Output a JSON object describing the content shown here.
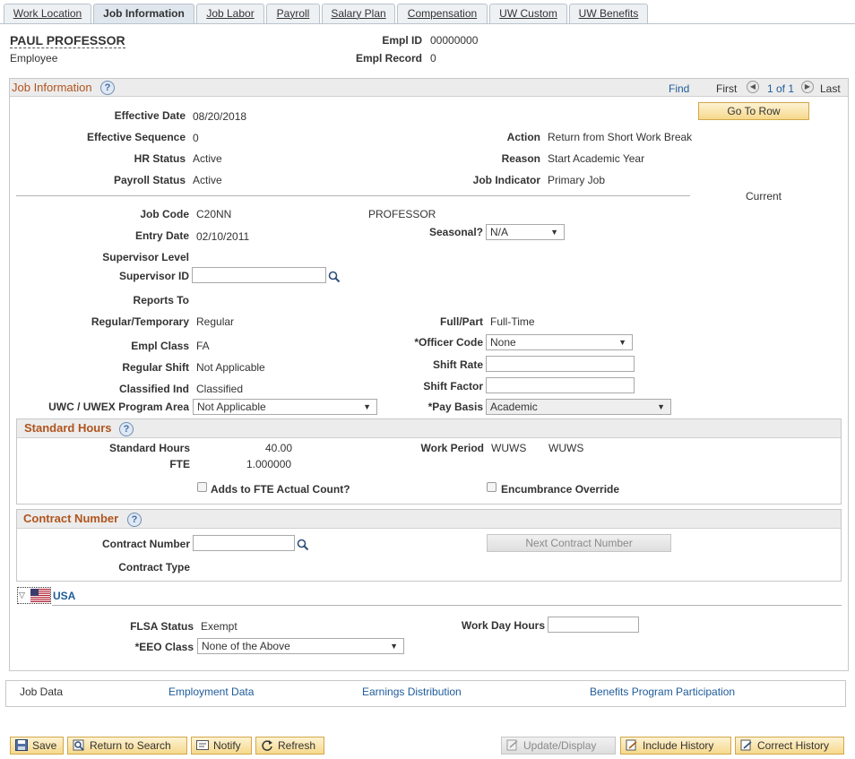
{
  "tabs": [
    {
      "label": "Work Location",
      "active": false
    },
    {
      "label": "Job Information",
      "active": true
    },
    {
      "label": "Job Labor",
      "active": false
    },
    {
      "label": "Payroll",
      "active": false
    },
    {
      "label": "Salary Plan",
      "active": false
    },
    {
      "label": "Compensation",
      "active": false
    },
    {
      "label": "UW Custom",
      "active": false
    },
    {
      "label": "UW Benefits",
      "active": false
    }
  ],
  "header": {
    "name": "PAUL PROFESSOR",
    "role": "Employee",
    "empl_id_label": "Empl ID",
    "empl_id": "00000000",
    "empl_record_label": "Empl Record",
    "empl_record": "0"
  },
  "job_info": {
    "title": "Job Information",
    "find": "Find",
    "first": "First",
    "count": "1 of 1",
    "last": "Last",
    "go_to_row": "Go To Row",
    "current": "Current",
    "effective_date_label": "Effective Date",
    "effective_date": "08/20/2018",
    "effective_sequence_label": "Effective Sequence",
    "effective_sequence": "0",
    "hr_status_label": "HR Status",
    "hr_status": "Active",
    "payroll_status_label": "Payroll Status",
    "payroll_status": "Active",
    "action_label": "Action",
    "action": "Return from Short Work Break",
    "reason_label": "Reason",
    "reason": "Start Academic Year",
    "job_indicator_label": "Job Indicator",
    "job_indicator": "Primary Job",
    "job_code_label": "Job Code",
    "job_code": "C20NN",
    "job_title": "PROFESSOR",
    "entry_date_label": "Entry Date",
    "entry_date": "02/10/2011",
    "seasonal_label": "Seasonal?",
    "seasonal": "N/A",
    "supervisor_level_label": "Supervisor Level",
    "supervisor_id_label": "Supervisor ID",
    "supervisor_id": "",
    "reports_to_label": "Reports To",
    "regular_temporary_label": "Regular/Temporary",
    "regular_temporary": "Regular",
    "full_part_label": "Full/Part",
    "full_part": "Full-Time",
    "empl_class_label": "Empl Class",
    "empl_class": "FA",
    "officer_code_label": "*Officer Code",
    "officer_code": "None",
    "regular_shift_label": "Regular Shift",
    "regular_shift": "Not Applicable",
    "shift_rate_label": "Shift Rate",
    "shift_rate": "",
    "classified_ind_label": "Classified Ind",
    "classified_ind": "Classified",
    "shift_factor_label": "Shift Factor",
    "shift_factor": "",
    "program_area_label": "UWC / UWEX Program Area",
    "program_area": "Not Applicable",
    "pay_basis_label": "*Pay Basis",
    "pay_basis": "Academic"
  },
  "standard_hours": {
    "title": "Standard Hours",
    "standard_hours_label": "Standard Hours",
    "standard_hours": "40.00",
    "fte_label": "FTE",
    "fte": "1.000000",
    "work_period_label": "Work Period",
    "work_period_code": "WUWS",
    "work_period_desc": "WUWS",
    "adds_to_fte_label": "Adds to FTE Actual Count?",
    "encumbrance_label": "Encumbrance Override"
  },
  "contract": {
    "title": "Contract Number",
    "contract_number_label": "Contract Number",
    "contract_number": "",
    "next_button": "Next Contract Number",
    "contract_type_label": "Contract Type"
  },
  "usa": {
    "label": "USA",
    "flsa_status_label": "FLSA Status",
    "flsa_status": "Exempt",
    "eeo_class_label": "*EEO Class",
    "eeo_class": "None of the Above",
    "work_day_hours_label": "Work Day Hours",
    "work_day_hours": ""
  },
  "footer_links": [
    "Job Data",
    "Employment Data",
    "Earnings Distribution",
    "Benefits Program Participation"
  ],
  "toolbar": {
    "save": "Save",
    "return_to_search": "Return to Search",
    "notify": "Notify",
    "refresh": "Refresh",
    "update_display": "Update/Display",
    "include_history": "Include History",
    "correct_history": "Correct History"
  },
  "colors": {
    "section_title": "#b0541d",
    "link": "#1f5b9b",
    "button_fill": "#f6d98c"
  }
}
